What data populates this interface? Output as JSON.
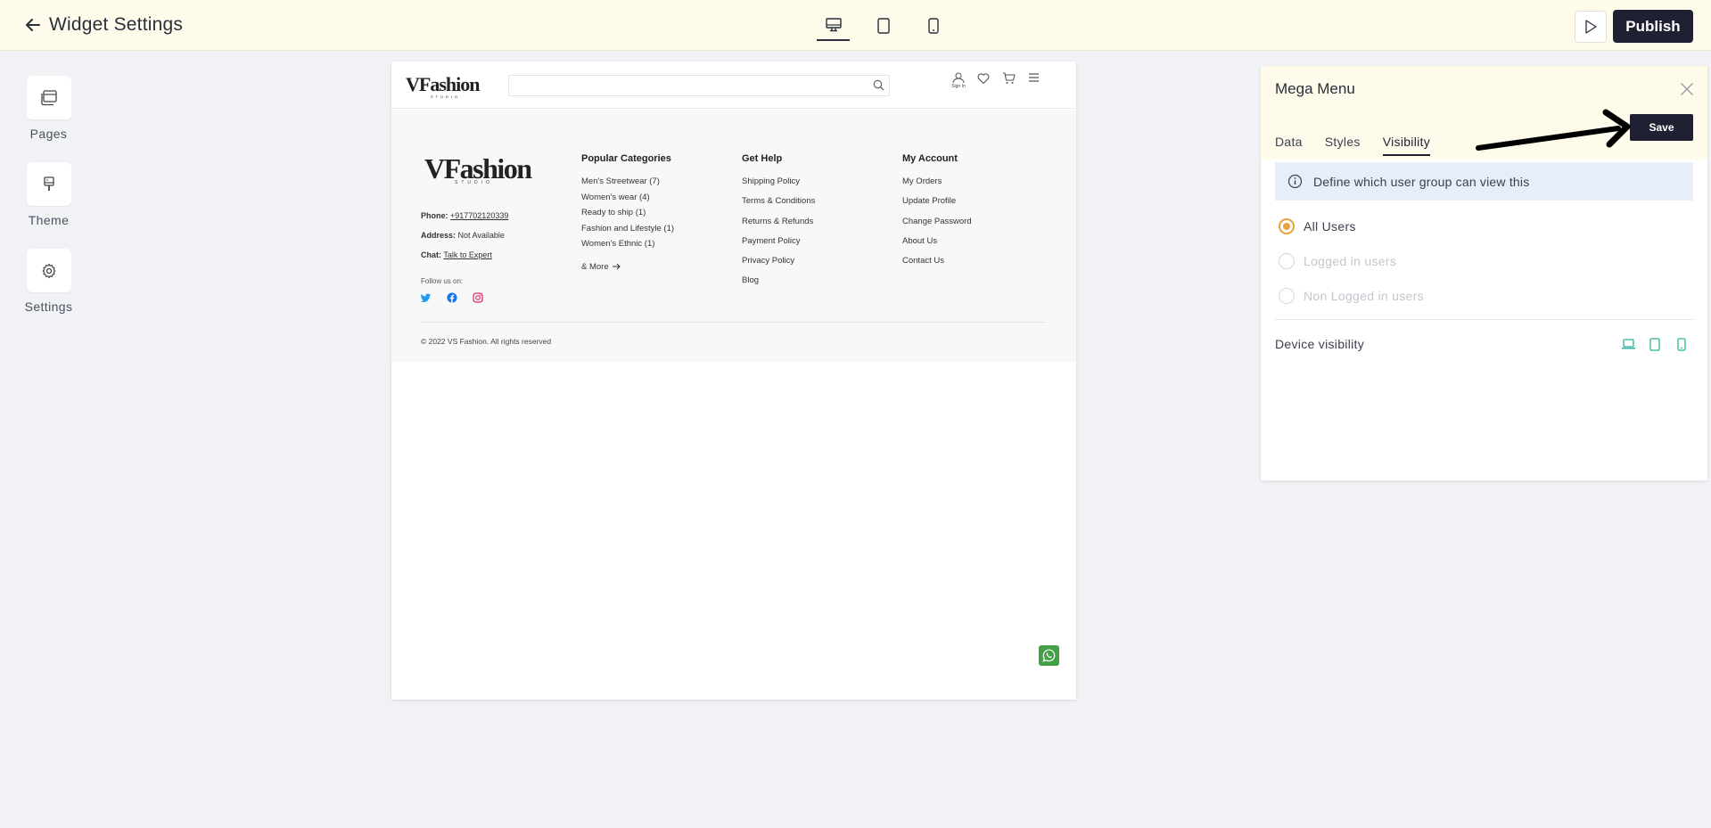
{
  "app": {
    "title": "Widget Settings",
    "publish_label": "Publish"
  },
  "sidebar": {
    "items": [
      {
        "label": "Pages",
        "icon": "pages-icon"
      },
      {
        "label": "Theme",
        "icon": "brush-icon"
      },
      {
        "label": "Settings",
        "icon": "gear-icon"
      }
    ]
  },
  "preview": {
    "header": {
      "logo_text": "VFashion",
      "logo_sub": "STUDIO",
      "signin_label": "Sign In"
    },
    "footer": {
      "logo_text": "VFashion",
      "logo_sub": "STUDIO",
      "phone_label": "Phone:",
      "phone_value": "+917702120339",
      "address_label": "Address:",
      "address_value": "Not Available",
      "chat_label": "Chat:",
      "chat_value": "Talk to Expert",
      "follow_label": "Follow us on:",
      "columns": [
        {
          "title": "Popular Categories",
          "links": [
            "Men's Streetwear (7)",
            "Women's wear (4)",
            "Ready to ship (1)",
            "Fashion and Lifestyle (1)",
            "Women's Ethnic (1)"
          ],
          "more": "& More"
        },
        {
          "title": "Get Help",
          "links": [
            "Shipping Policy",
            "Terms & Conditions",
            "Returns & Refunds",
            "Payment Policy",
            "Privacy Policy",
            "Blog"
          ]
        },
        {
          "title": "My Account",
          "links": [
            "My Orders",
            "Update Profile",
            "Change Password",
            "About Us",
            "Contact Us"
          ]
        }
      ],
      "copyright": "© 2022 VS Fashion. All rights reserved"
    }
  },
  "panel": {
    "title": "Mega Menu",
    "save_label": "Save",
    "tabs": [
      "Data",
      "Styles",
      "Visibility"
    ],
    "active_tab": "Visibility",
    "info_text": "Define which user group can view this",
    "options": [
      {
        "label": "All Users",
        "checked": true
      },
      {
        "label": "Logged in users",
        "checked": false
      },
      {
        "label": "Non Logged in users",
        "checked": false
      }
    ],
    "device_visibility_label": "Device visibility"
  },
  "colors": {
    "topbar_bg": "#fefbea",
    "primary_dark": "#1f2133",
    "radio_accent": "#e9a23b",
    "device_icon_accent": "#2bb39a",
    "whatsapp": "#43a047"
  }
}
